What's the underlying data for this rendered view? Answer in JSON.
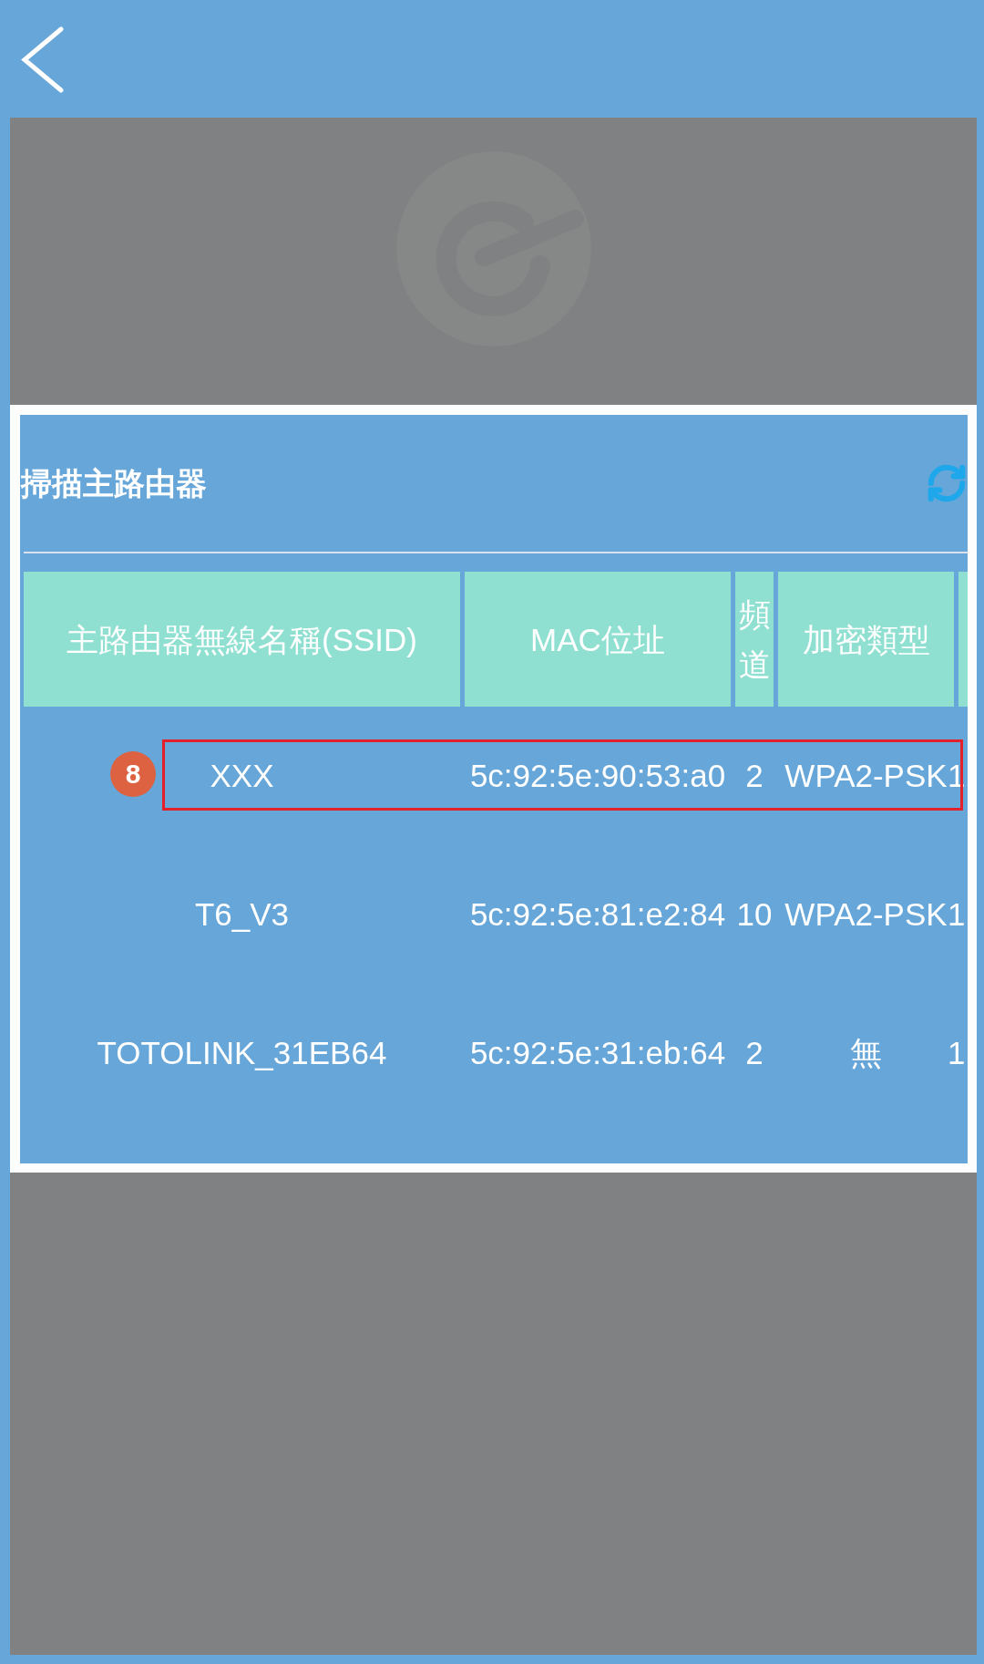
{
  "dialog": {
    "title": "掃描主路由器",
    "table": {
      "columns": [
        "主路由器無線名稱(SSID)",
        "MAC位址",
        "頻道",
        "加密類型"
      ],
      "rows": [
        {
          "cells": [
            "XXX",
            "5c:92:5e:90:53:a0",
            "2",
            "WPA2-PSK",
            "1"
          ],
          "highlighted": true,
          "badge": "8"
        },
        {
          "cells": [
            "T6_V3",
            "5c:92:5e:81:e2:84",
            "10",
            "WPA2-PSK",
            "1"
          ],
          "highlighted": false
        },
        {
          "cells": [
            "TOTOLINK_31EB64",
            "5c:92:5e:31:eb:64",
            "2",
            "無",
            "1"
          ],
          "highlighted": false
        }
      ]
    }
  }
}
